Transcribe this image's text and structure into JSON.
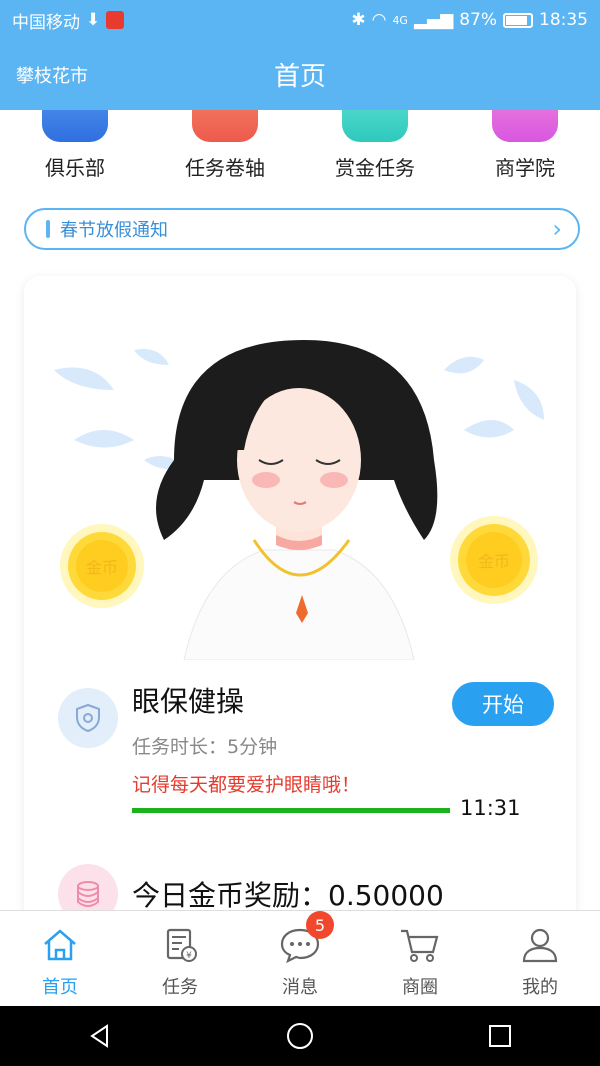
{
  "status": {
    "carrier": "中国移动",
    "battery": "87%",
    "time": "18:35",
    "network": "4G"
  },
  "header": {
    "city": "攀枝花市",
    "title": "首页"
  },
  "quick_links": [
    {
      "label": "俱乐部",
      "color": "#3b7fe6"
    },
    {
      "label": "任务卷轴",
      "color": "#f06b58"
    },
    {
      "label": "赏金任务",
      "color": "#3ed6c9"
    },
    {
      "label": "商学院",
      "color": "#e866d6"
    }
  ],
  "notice": {
    "text": "春节放假通知"
  },
  "task": {
    "title": "眼保健操",
    "duration": "任务时长：5分钟",
    "tip": "记得每天都要爱护眼睛哦！",
    "start_label": "开始",
    "timer": "11:31",
    "progress": 1.0,
    "coin_left": "金币",
    "coin_right": "金币"
  },
  "reward": {
    "text": "今日金币奖励：0.50000"
  },
  "tabs": [
    {
      "label": "首页",
      "icon": "home-icon",
      "active": true
    },
    {
      "label": "任务",
      "icon": "task-icon",
      "active": false
    },
    {
      "label": "消息",
      "icon": "message-icon",
      "active": false,
      "badge": "5"
    },
    {
      "label": "商圈",
      "icon": "cart-icon",
      "active": false
    },
    {
      "label": "我的",
      "icon": "user-icon",
      "active": false
    }
  ],
  "colors": {
    "primary": "#5cb5f3",
    "accent": "#2aa0f0",
    "tip": "#e53c2f",
    "progress": "#1bb21b"
  }
}
